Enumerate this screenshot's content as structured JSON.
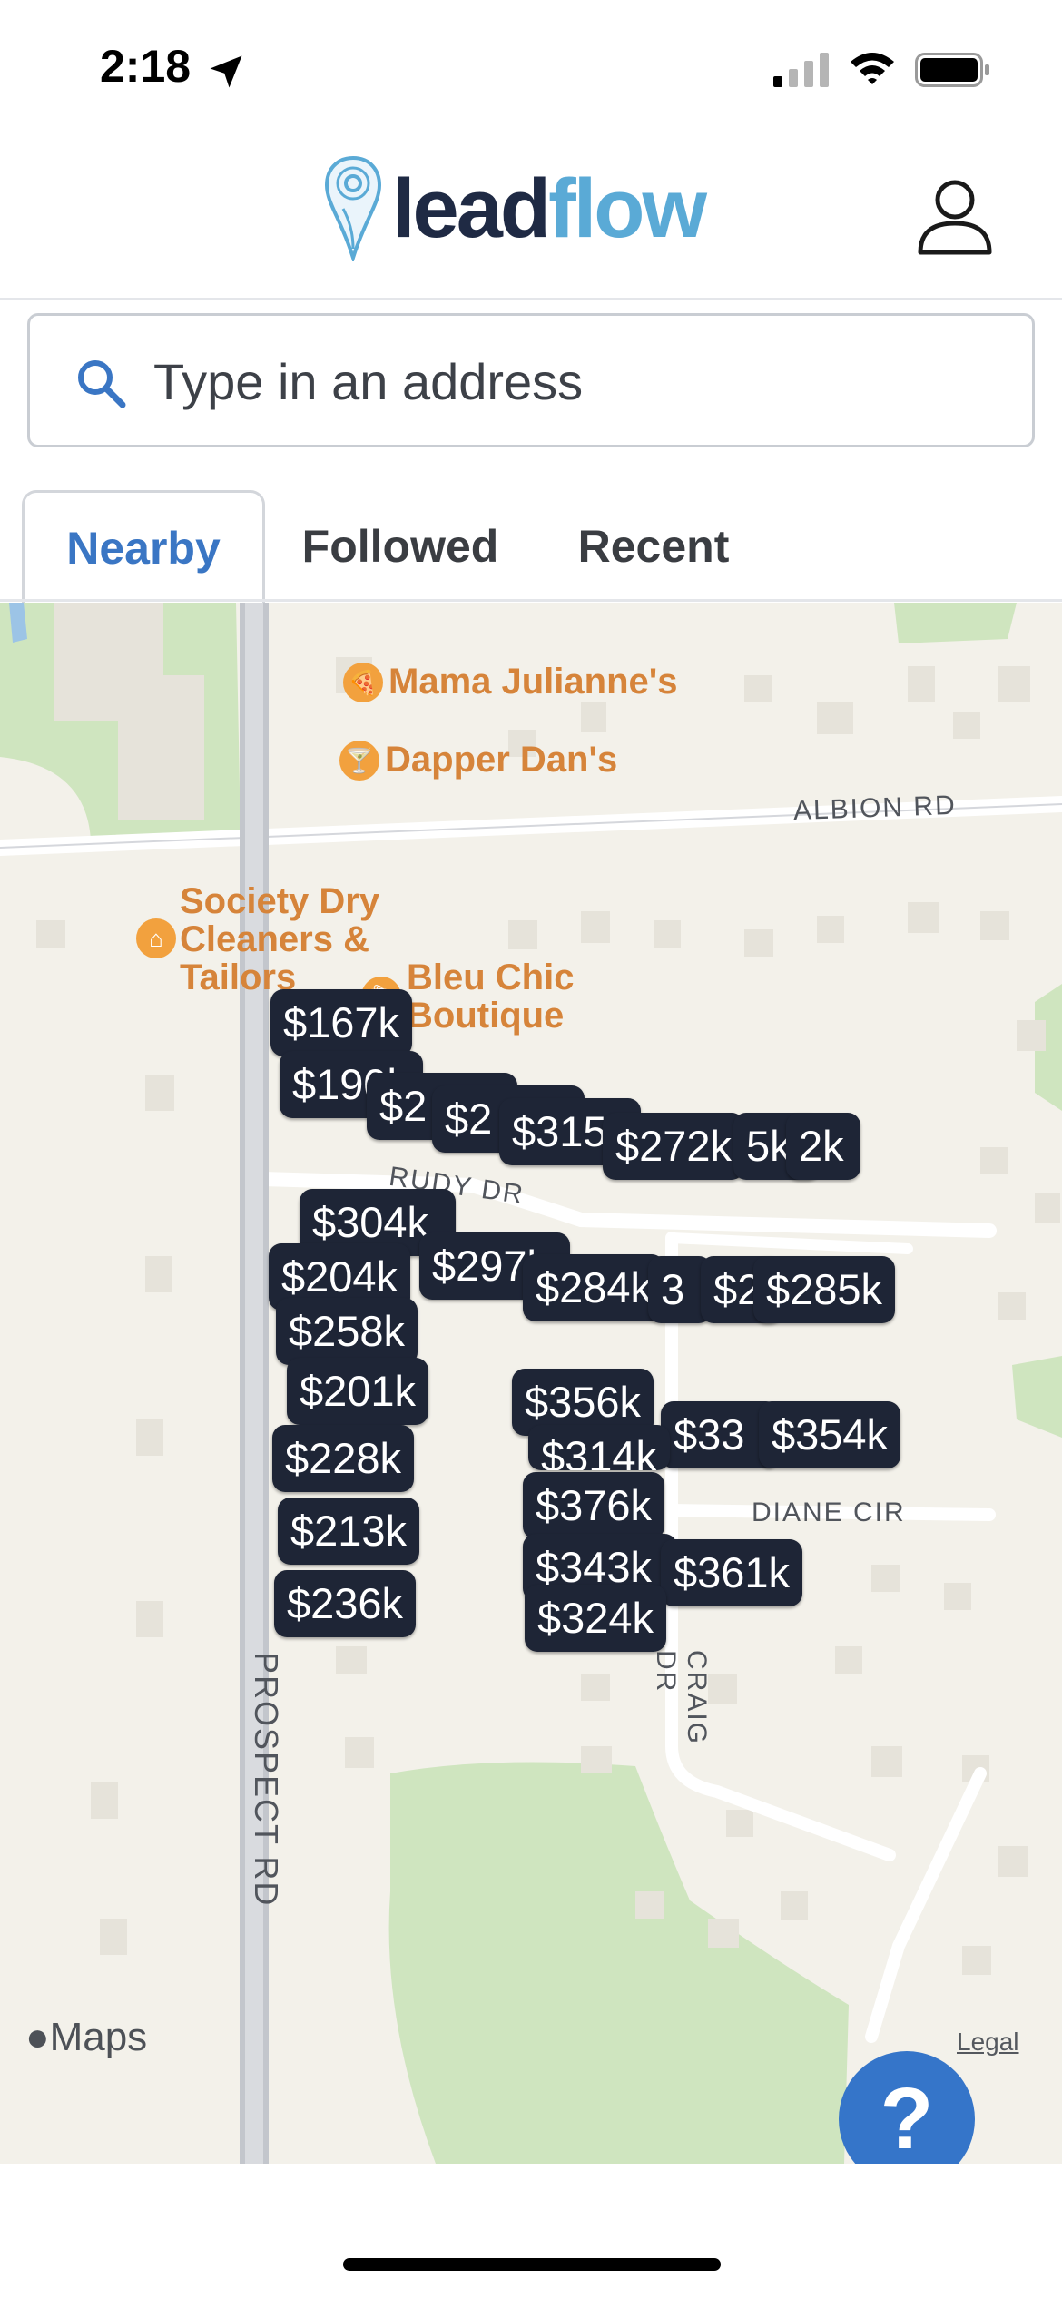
{
  "status_bar": {
    "time": "2:18"
  },
  "header": {
    "logo_lead": "lead",
    "logo_flow": "flow"
  },
  "search": {
    "placeholder": "Type in an address"
  },
  "tabs": [
    {
      "label": "Nearby",
      "active": true
    },
    {
      "label": "Followed",
      "active": false
    },
    {
      "label": "Recent",
      "active": false
    }
  ],
  "map": {
    "pois": [
      {
        "name": "Mama Julianne's",
        "icon": "pizza-icon"
      },
      {
        "name": "Dapper Dan's",
        "icon": "cocktail-icon"
      },
      {
        "name": "Society Dry Cleaners & Tailors",
        "icon": "hanger-icon"
      },
      {
        "name": "Bleu Chic Boutique",
        "icon": "shopping-bag-icon"
      }
    ],
    "streets": [
      "ALBION RD",
      "RUDY DR",
      "DIANE CIR",
      "PROSPECT RD",
      "CRAIG DR"
    ],
    "markers": [
      "$167k",
      "$190k",
      "$2",
      "$2",
      "$315",
      "$272k",
      "5k",
      "2k",
      "$304k",
      "$204k",
      "$297k",
      "$284k",
      "3",
      "$2",
      "$285k",
      "$258k",
      "$201k",
      "$356k",
      "$33",
      "$354k",
      "$228k",
      "$314k",
      "$376k",
      "$213k",
      "$343k",
      "$361k",
      "$236k",
      "$324k"
    ],
    "credit": "Maps",
    "legal": "Legal"
  },
  "help": {
    "label": "?"
  },
  "colors": {
    "brand_dark": "#1f2a44",
    "brand_light": "#5aaad6",
    "accent": "#3575c9",
    "marker_bg": "#1e2536",
    "poi_orange": "#d6843a"
  }
}
